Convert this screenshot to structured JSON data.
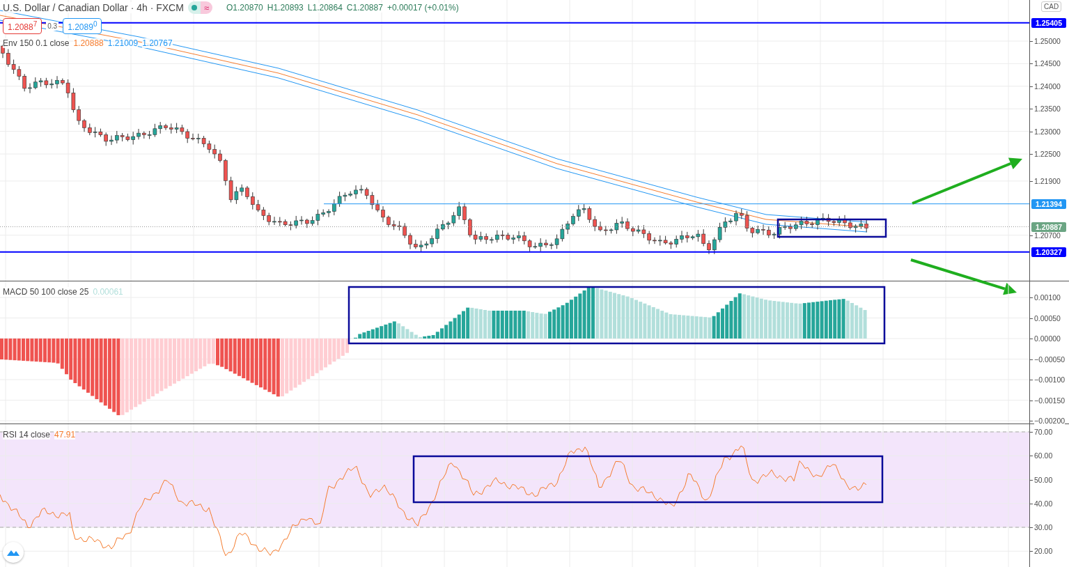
{
  "header": {
    "symbol": "U.S. Dollar / Canadian Dollar · 4h · FXCM",
    "badge": "≈",
    "ohlc": [
      "O1.20870",
      "H1.20893",
      "L1.20864",
      "C1.20887",
      "+0.00017 (+0.01%)"
    ]
  },
  "trade": {
    "sell": "1.2088$^{7}$",
    "spread": "0.3",
    "buy": "1.2089$^{0}$"
  },
  "axis_unit": "CAD",
  "panes": [
    {
      "kind": "price",
      "legend": "Env 150 0.1 close",
      "values": [
        {
          "text": "1.20888",
          "color": "#f57c2e"
        },
        {
          "text": "1.21009",
          "color": "#2196f3"
        },
        {
          "text": "1.20767",
          "color": "#2196f3"
        }
      ],
      "ticks": [
        "1.25000",
        "1.24500",
        "1.24000",
        "1.23500",
        "1.23000",
        "1.22500",
        "1.21900",
        "1.20700"
      ],
      "markers": [
        {
          "text": "1.25405",
          "color": "#0000ff"
        },
        {
          "text": "1.21394",
          "color": "#2196f3"
        },
        {
          "text": "1.20887",
          "color": "#6ba583"
        },
        {
          "text": "1.20327",
          "color": "#0000ff"
        }
      ]
    },
    {
      "kind": "macd",
      "legend": "MACD 50 100 close 25",
      "values": [
        {
          "text": "0.00061",
          "color": "#b2dfdb"
        }
      ],
      "ticks": [
        "0.00100",
        "0.00050",
        "0.00000",
        "−0.00050",
        "−0.00100",
        "−0.00150",
        "−0.00200"
      ]
    },
    {
      "kind": "rsi",
      "legend": "RSI 14 close",
      "values": [
        {
          "text": "47.91",
          "color": "#f57c2e"
        }
      ],
      "ticks": [
        "70.00",
        "60.00",
        "50.00",
        "40.00",
        "30.00",
        "20.00"
      ]
    }
  ]
}
